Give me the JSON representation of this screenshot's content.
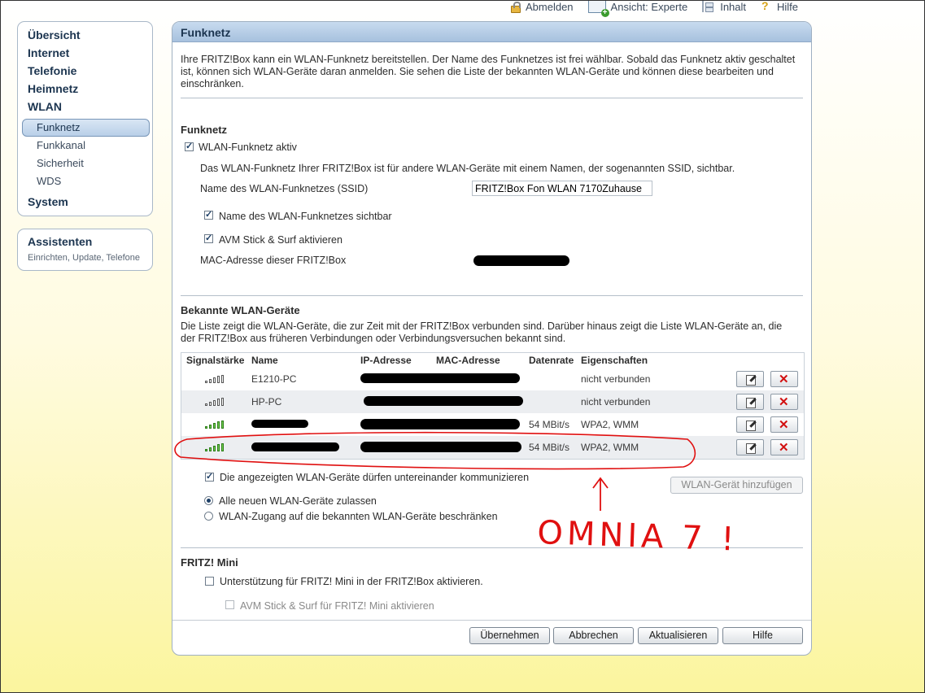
{
  "toplinks": {
    "logout": "Abmelden",
    "view": "Ansicht: Experte",
    "contents": "Inhalt",
    "help": "Hilfe"
  },
  "nav": {
    "uebersicht": "Übersicht",
    "internet": "Internet",
    "telefonie": "Telefonie",
    "heimnetz": "Heimnetz",
    "wlan": "WLAN",
    "funknetz": "Funknetz",
    "funkkanal": "Funkkanal",
    "sicherheit": "Sicherheit",
    "wds": "WDS",
    "system": "System"
  },
  "assistant": {
    "title": "Assistenten",
    "subtitle": "Einrichten, Update, Telefone"
  },
  "panel": {
    "title": "Funknetz",
    "intro": "Ihre FRITZ!Box kann ein WLAN-Funknetz bereitstellen. Der Name des Funknetzes ist frei wählbar. Sobald das Funknetz aktiv geschaltet ist, können sich WLAN-Geräte daran anmelden. Sie sehen die Liste der bekannten WLAN-Geräte und können diese bearbeiten und einschränken."
  },
  "funknetz": {
    "heading": "Funknetz",
    "active_label": "WLAN-Funknetz aktiv",
    "active_checked": true,
    "ssid_desc": "Das WLAN-Funknetz Ihrer FRITZ!Box ist für andere WLAN-Geräte mit einem Namen, der sogenannten SSID, sichtbar.",
    "ssid_label": "Name des WLAN-Funknetzes (SSID)",
    "ssid_value": "FRITZ!Box Fon WLAN 7170Zuhause",
    "visible_label": "Name des WLAN-Funknetzes sichtbar",
    "visible_checked": true,
    "stick_label": "AVM Stick & Surf aktivieren",
    "stick_checked": true,
    "mac_label": "MAC-Adresse dieser FRITZ!Box"
  },
  "devices": {
    "heading": "Bekannte WLAN-Geräte",
    "desc": "Die Liste zeigt die WLAN-Geräte, die zur Zeit mit der FRITZ!Box verbunden sind. Darüber hinaus zeigt die Liste WLAN-Geräte an, die der FRITZ!Box aus früheren Verbindungen oder Verbindungsversuchen bekannt sind.",
    "columns": {
      "signal": "Signalstärke",
      "name": "Name",
      "ip": "IP-Adresse",
      "mac": "MAC-Adresse",
      "rate": "Datenrate",
      "props": "Eigenschaften"
    },
    "rows": [
      {
        "name": "E1210-PC",
        "rate": "",
        "props": "nicht verbunden",
        "signal_bars_filled": 0
      },
      {
        "name": "HP-PC",
        "rate": "",
        "props": "nicht verbunden",
        "signal_bars_filled": 0
      },
      {
        "name": "",
        "rate": "54 MBit/s",
        "props": "WPA2, WMM",
        "signal_bars_filled": 5
      },
      {
        "name": "",
        "rate": "54 MBit/s",
        "props": "WPA2, WMM",
        "signal_bars_filled": 5
      }
    ],
    "communicate_label": "Die angezeigten WLAN-Geräte dürfen untereinander kommunizieren",
    "communicate_checked": true,
    "add_button": "WLAN-Gerät hinzufügen",
    "radio_all": "Alle neuen WLAN-Geräte zulassen",
    "radio_restrict": "WLAN-Zugang auf die bekannten WLAN-Geräte beschränken",
    "radio_selected": "all"
  },
  "mini": {
    "heading": "FRITZ! Mini",
    "support_label": "Unterstützung für FRITZ! Mini in der FRITZ!Box aktivieren.",
    "support_checked": false,
    "stick_label": "AVM Stick & Surf für FRITZ! Mini aktivieren",
    "stick_checked": false
  },
  "buttons": {
    "apply": "Übernehmen",
    "cancel": "Abbrechen",
    "refresh": "Aktualisieren",
    "help": "Hilfe"
  },
  "annotation": {
    "text": "OMNIA 7 !",
    "color": "#e01010"
  }
}
